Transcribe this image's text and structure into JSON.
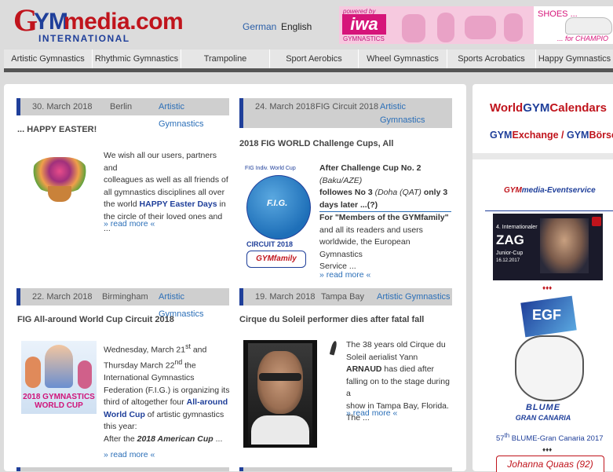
{
  "header": {
    "logo_text": "GYMmedia.com",
    "logo_sub": "INTERNATIONAL",
    "lang_de": "German",
    "lang_en": "English",
    "banner_powered": "powered by",
    "banner_brand": "iwa",
    "banner_gym": "GYMNASTICS",
    "banner_shoes": "SHOES ...",
    "banner_champ": "... for CHAMPIO"
  },
  "nav": [
    "Artistic Gymnastics",
    "Rhythmic Gymnastics",
    "Trampoline",
    "Sport Aerobics",
    "Wheel Gymnastics",
    "Sports Acrobatics",
    "Happy Gymnastics"
  ],
  "articles": [
    {
      "date": "30. March 2018",
      "place": "Berlin",
      "category": "Artistic Gymnastics",
      "title": "... HAPPY EASTER!",
      "more": "» read more «"
    },
    {
      "date": "24. March 2018",
      "place": "FIG Circuit 2018",
      "category": "Artistic Gymnastics",
      "title": "2018 FIG WORLD Challenge Cups, All",
      "more": "» read more «"
    },
    {
      "date": "22. March 2018",
      "place": "Birmingham",
      "category": "Artistic Gymnastics",
      "title": "FIG All-around World Cup Circuit 2018",
      "more": "» read more «"
    },
    {
      "date": "19. March 2018",
      "place": "Tampa Bay",
      "category": "Artistic Gymnastics",
      "title": "Cirque du Soleil performer dies after fatal fall",
      "more": "» read more «"
    }
  ],
  "a1": {
    "t1": "We wish all our users, partners and",
    "t2": "colleagues as well as all friends of",
    "t3": "all gymnastics disciplines all over",
    "t4a": "the world ",
    "t4b": "HAPPY Easter Days",
    "t4c": " in",
    "t5": "the circle of their loved ones and ..."
  },
  "a2": {
    "img_top": "FIG Indiv. World Cup",
    "img_bottom": "CIRCUIT 2018",
    "img_family": "GYMfamily",
    "img_fig": "F.I.G.",
    "t1": "After Challenge Cup No. 2",
    "t2": "(Baku/AZE)",
    "t3a": "followes No 3 ",
    "t3b": "(Doha (QAT)",
    "t3c": " only 3",
    "t4": "days later ...(?)",
    "t5": "For \"Members of the GYMfamily\"",
    "t6": "and all its readers and users",
    "t7": "worldwide, the European Gymnastics",
    "t8": "Service ..."
  },
  "a3": {
    "img_line1": "2018 GYMNASTICS",
    "img_line2": "WORLD CUP",
    "t1a": "Wednesday, March 21",
    "t1sup": "st",
    "t1b": " and",
    "t2a": "Thursday March 22",
    "t2sup": "nd",
    "t2b": "  the",
    "t3": "International Gymnastics",
    "t4": "Federation (F.I.G.) is organizing its",
    "t5a": "third of altogether four ",
    "t5b": "All-around",
    "t6a": "World Cup",
    "t6b": " of artistic gymnastics",
    "t7": "this year:",
    "t8a": "After the ",
    "t8b": "2018 American Cup",
    "t8c": " ..."
  },
  "a4": {
    "t1": "The 38 years old Cirque du",
    "t2": "Soleil aerialist Yann",
    "t3a": "ARNAUD",
    "t3b": " has died after",
    "t4": "falling on to the stage during a",
    "t5": "show in Tampa Bay, Florida. The ..."
  },
  "side": {
    "world_a": "World",
    "world_b": "Calendars",
    "exchange": "Exchange",
    "slash": "/",
    "boerse": "Börse",
    "events": "media-Eventservice",
    "zag_line1": "4. Internationaler",
    "zag_name": "ZAG",
    "zag_line3": "Junior-Cup",
    "zag_date": "16.12.2017",
    "diamonds1": "♦♦♦",
    "egf": "EGF",
    "blume": "BLUME",
    "gran": "GRAN CANARIA",
    "caption_a": "57",
    "caption_sup": "th",
    "caption_b": " BLUME-Gran Canaria 2017",
    "diamonds2": "♦♦♦",
    "johanna": "Johanna Quaas (92)"
  },
  "colors": {
    "brand_red": "#c0141c",
    "brand_blue": "#1f3f9a",
    "link": "#2b6fb8",
    "nav_bg": "#e6e6e6",
    "header_bar": "#cfcfcf",
    "iwa_pink": "#d6157a"
  }
}
